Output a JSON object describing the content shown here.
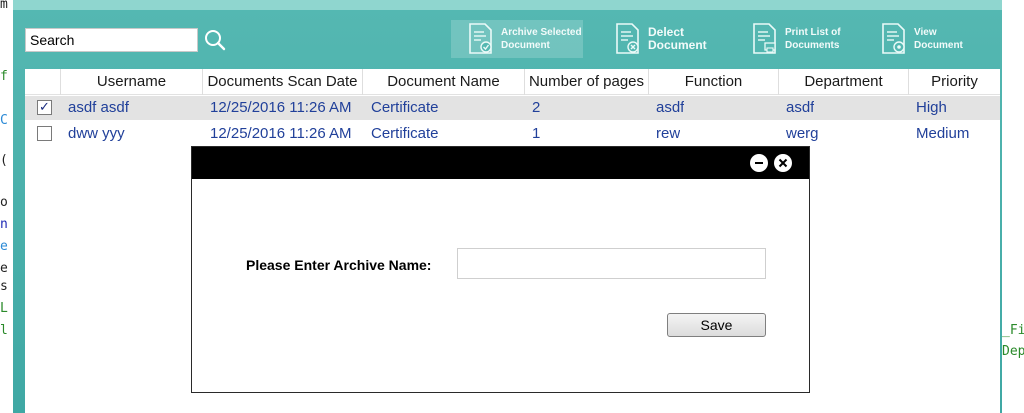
{
  "colors": {
    "app_bg": "#4fb3ae",
    "app_top": "#8fd6cf",
    "cell_text": "#21409a",
    "selected_row": "#e3e3e3",
    "dialog_titlebar": "#000000"
  },
  "background_code": {
    "left": [
      {
        "text": "m",
        "color": "#1f1f1f"
      },
      {
        "text": "f",
        "color": "#2a8a2a"
      },
      {
        "text": "C",
        "color": "#2b8ad6"
      },
      {
        "text": "(",
        "color": "#1f1f1f"
      },
      {
        "text": "o",
        "color": "#1f1f1f"
      },
      {
        "text": "n",
        "color": "#1f2ab6"
      },
      {
        "text": "e",
        "color": "#2b8ad6"
      },
      {
        "text": "e",
        "color": "#1f1f1f"
      },
      {
        "text": "s",
        "color": "#1f1f1f"
      },
      {
        "text": "L",
        "color": "#2a8a2a"
      },
      {
        "text": "l",
        "color": "#2a8a2a"
      }
    ],
    "right": [
      {
        "text": "_Fi",
        "color": "#2a8a2a"
      },
      {
        "text": "Dep",
        "color": "#2a8a2a"
      }
    ]
  },
  "search": {
    "value": "Search",
    "icon": "search-icon"
  },
  "toolbar": {
    "archive": {
      "line1": "Archive Selected",
      "line2": "Document",
      "icon": "document-check-icon"
    },
    "delete": {
      "line1": "Delect",
      "line2": "Document",
      "icon": "document-delete-icon"
    },
    "print": {
      "line1": "Print List of",
      "line2": "Documents",
      "icon": "document-print-icon"
    },
    "view": {
      "line1": "View",
      "line2": "Document",
      "icon": "document-view-icon"
    }
  },
  "table": {
    "columns": [
      "Username",
      "Documents Scan Date",
      "Document Name",
      "Number of pages",
      "Function",
      "Department",
      "Priority"
    ],
    "rows": [
      {
        "checked": true,
        "username": "asdf asdf",
        "scan_date": "12/25/2016 11:26 AM",
        "doc_name": "Certificate",
        "pages": "2",
        "function": "asdf",
        "department": "asdf",
        "priority": "High"
      },
      {
        "checked": false,
        "username": "dww yyy",
        "scan_date": "12/25/2016 11:26 AM",
        "doc_name": "Certificate",
        "pages": "1",
        "function": "rew",
        "department": "werg",
        "priority": "Medium"
      }
    ]
  },
  "dialog": {
    "label": "Please Enter Archive Name:",
    "input_value": "",
    "save_label": "Save",
    "checkbox_glyph": "✓"
  }
}
